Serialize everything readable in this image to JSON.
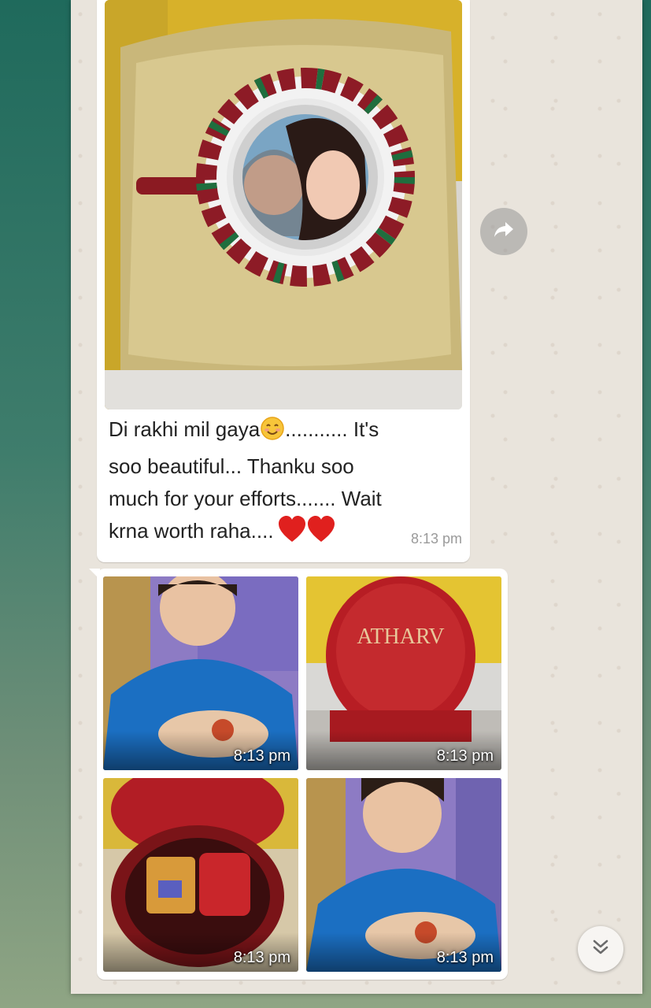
{
  "chat": {
    "message_1": {
      "caption_part1": "Di rakhi mil gaya",
      "caption_part2": "........... It's\nsoo beautiful... Thanku soo\nmuch for your efforts....... Wait\nkrna worth raha....",
      "time": "8:13 pm"
    },
    "message_2": {
      "photos": [
        {
          "time": "8:13 pm"
        },
        {
          "time": "8:13 pm",
          "box_label": "ATHARV"
        },
        {
          "time": "8:13 pm"
        },
        {
          "time": "8:13 pm"
        }
      ]
    }
  },
  "icons": {
    "forward": "forward-arrow-icon",
    "scroll_down": "double-chevron-down-icon",
    "smile_emoji": "smiling-face-emoji",
    "heart_emoji": "red-heart-emoji"
  },
  "colors": {
    "bubble": "#ffffff",
    "wallpaper": "#e9e4dc",
    "timestamp": "#9a9a9a",
    "heart": "#e0201e"
  }
}
